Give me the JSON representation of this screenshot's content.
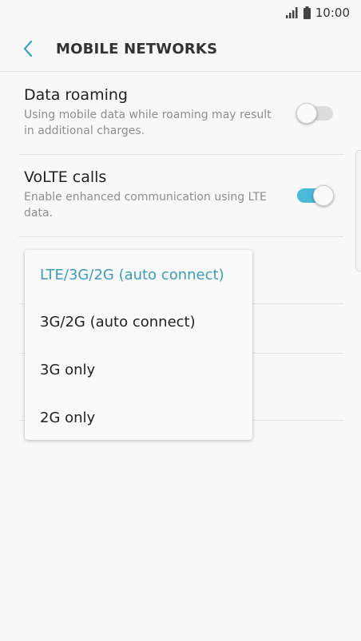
{
  "status": {
    "time": "10:00"
  },
  "header": {
    "title": "MOBILE NETWORKS"
  },
  "settings": [
    {
      "title": "Data roaming",
      "desc": "Using mobile data while roaming may result in additional charges.",
      "enabled": false
    },
    {
      "title": "VoLTE calls",
      "desc": "Enable enhanced communication using LTE data.",
      "enabled": true
    }
  ],
  "network_mode_options": [
    {
      "label": "LTE/3G/2G (auto connect)",
      "selected": true
    },
    {
      "label": "3G/2G (auto connect)",
      "selected": false
    },
    {
      "label": "3G only",
      "selected": false
    },
    {
      "label": "2G only",
      "selected": false
    }
  ],
  "colors": {
    "accent": "#4ab9da",
    "selected_text": "#3b9cbb",
    "switch_off": "#dcdcdc"
  }
}
